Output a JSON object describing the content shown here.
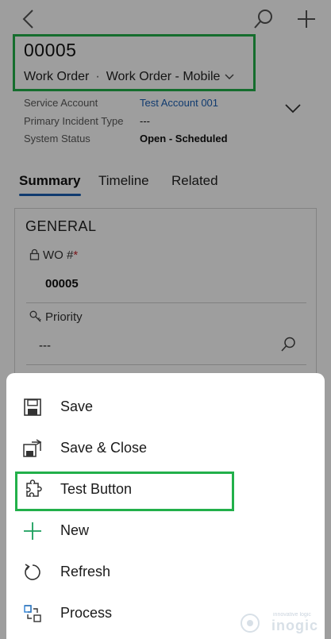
{
  "record": {
    "title": "00005",
    "entity": "Work Order",
    "separator": "·",
    "form_name": "Work Order - Mobile"
  },
  "header_fields": [
    {
      "label": "Service Account",
      "value": "Test Account 001"
    },
    {
      "label": "Primary Incident Type",
      "value": "---"
    },
    {
      "label": "System Status",
      "value": "Open - Scheduled"
    }
  ],
  "tabs": [
    {
      "label": "Summary",
      "active": true
    },
    {
      "label": "Timeline",
      "active": false
    },
    {
      "label": "Related",
      "active": false
    }
  ],
  "section": {
    "title": "GENERAL",
    "wo_label": "WO #",
    "wo_required_marker": "*",
    "wo_value": "00005",
    "priority_label": "Priority",
    "priority_value": "---"
  },
  "menu": {
    "save": "Save",
    "save_close": "Save & Close",
    "test_button": "Test Button",
    "new": "New",
    "refresh": "Refresh",
    "process": "Process"
  },
  "icons": {
    "back": "back-chevron-icon",
    "search": "search-icon",
    "add": "plus-icon",
    "expand": "chevron-down-icon",
    "lock": "lock-icon",
    "key": "key-icon",
    "save": "save-disk-icon",
    "save_close": "save-close-icon",
    "test": "puzzle-icon",
    "new": "plus-icon",
    "refresh": "refresh-icon",
    "process": "process-flow-icon"
  },
  "colors": {
    "highlight": "#22b04a",
    "link": "#1b5fb4",
    "required": "#c4262e",
    "new_icon": "#1a9e5c"
  },
  "watermark": {
    "tagline": "innovative logic",
    "brand": "inogic"
  }
}
